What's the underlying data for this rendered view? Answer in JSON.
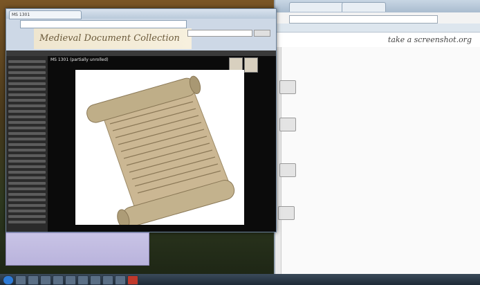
{
  "colors": {
    "desktop": "#6b4a1e",
    "window_frame": "#cdd8e6",
    "viewer_bg": "#0b0b0b",
    "sheet_bg": "#c9c4e6"
  },
  "left_window": {
    "tab_label": "MS 1301",
    "address": "",
    "banner_title": "Medieval Document Collection",
    "search_placeholder": "",
    "search_button": "",
    "viewer_title": "MS 1301 (partially unrolled)",
    "viewer_links": "",
    "zoom_label": "",
    "photo_caption": ""
  },
  "right_window": {
    "tabs": [
      "",
      ""
    ],
    "address": "",
    "site_logo": "take a screenshot.org",
    "nav_links": "",
    "rows": [
      {
        "text": ""
      },
      {
        "text": ""
      },
      {
        "text": ""
      },
      {
        "text": ""
      }
    ],
    "questions": [
      "",
      ""
    ]
  },
  "sheet": {
    "rows": [
      [
        "",
        "",
        "",
        ""
      ],
      [
        "",
        "",
        "",
        ""
      ],
      [
        "",
        "",
        "",
        ""
      ]
    ]
  },
  "taskbar": {
    "clock": ""
  }
}
